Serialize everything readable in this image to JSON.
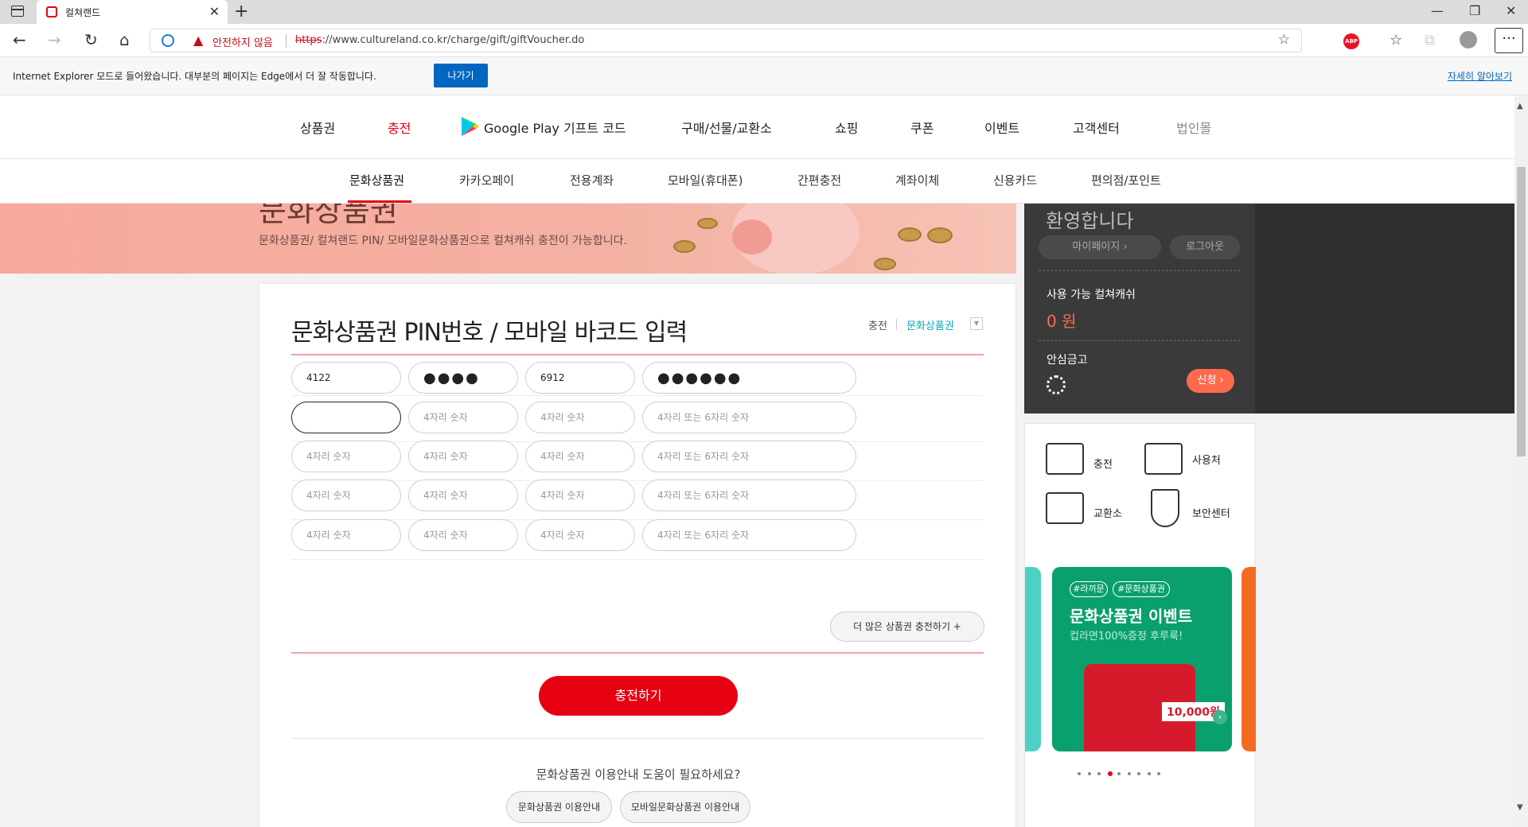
{
  "browser": {
    "tab_title": "컬쳐랜드",
    "unsafe_label": "안전하지 않음",
    "url_scheme": "https",
    "url_rest": "://www.cultureland.co.kr/charge/gift/giftVoucher.do",
    "abp_label": "ABP",
    "ie_message": "Internet Explorer 모드로 들어왔습니다. 대부분의 페이지는 Edge에서 더 잘 작동합니다.",
    "ie_leave": "나가기",
    "ie_more": "자세히 알아보기"
  },
  "gnb": [
    "상품권",
    "충전",
    "Google Play 기프트 코드",
    "구매/선물/교환소",
    "쇼핑",
    "쿠폰",
    "이벤트",
    "고객센터",
    "법인몰"
  ],
  "snb": [
    "문화상품권",
    "카카오페이",
    "전용계좌",
    "모바일(휴대폰)",
    "간편충전",
    "계좌이체",
    "신용카드",
    "편의점/포인트"
  ],
  "banner": {
    "title": "문화상품권",
    "desc": "문화상품권/ 컬쳐랜드 PIN/ 모바일문화상품권으로 컬쳐캐쉬 충전이 가능합니다."
  },
  "user_panel": {
    "welcome": "환영합니다",
    "mypage": "마이페이지 ›",
    "logout": "로그아웃",
    "cash_label": "사용 가능 컬쳐캐쉬",
    "cash_value": "0 원",
    "safe_label": "안심금고",
    "apply": "신청 ›"
  },
  "quick_menu": {
    "charge": "충전",
    "usage": "사용처",
    "exchange": "교환소",
    "security": "보안센터"
  },
  "event": {
    "tag1": "#라끼문",
    "tag2": "#문화상품권",
    "title": "문화상품권 이벤트",
    "subtitle": "컵라면100%증정 후루룩!",
    "price": "10,000원",
    "dots": 9,
    "active_dot": 3
  },
  "form": {
    "title": "문화상품권 PIN번호 / 모바일 바코드 입력",
    "breadcrumb1": "충전",
    "breadcrumb2": "문화상품권",
    "placeholder4": "4자리 숫자",
    "placeholder46": "4자리 또는 6자리 숫자",
    "row1": [
      "4122",
      "●●●●",
      "6912",
      "●●●●●●"
    ],
    "more_button": "더 많은 상품권 충전하기 +",
    "charge_button": "충전하기",
    "help_question": "문화상품권 이용안내 도움이 필요하세요?",
    "help_btn1": "문화상품권 이용안내",
    "help_btn2": "모바일문화상품권 이용안내"
  }
}
